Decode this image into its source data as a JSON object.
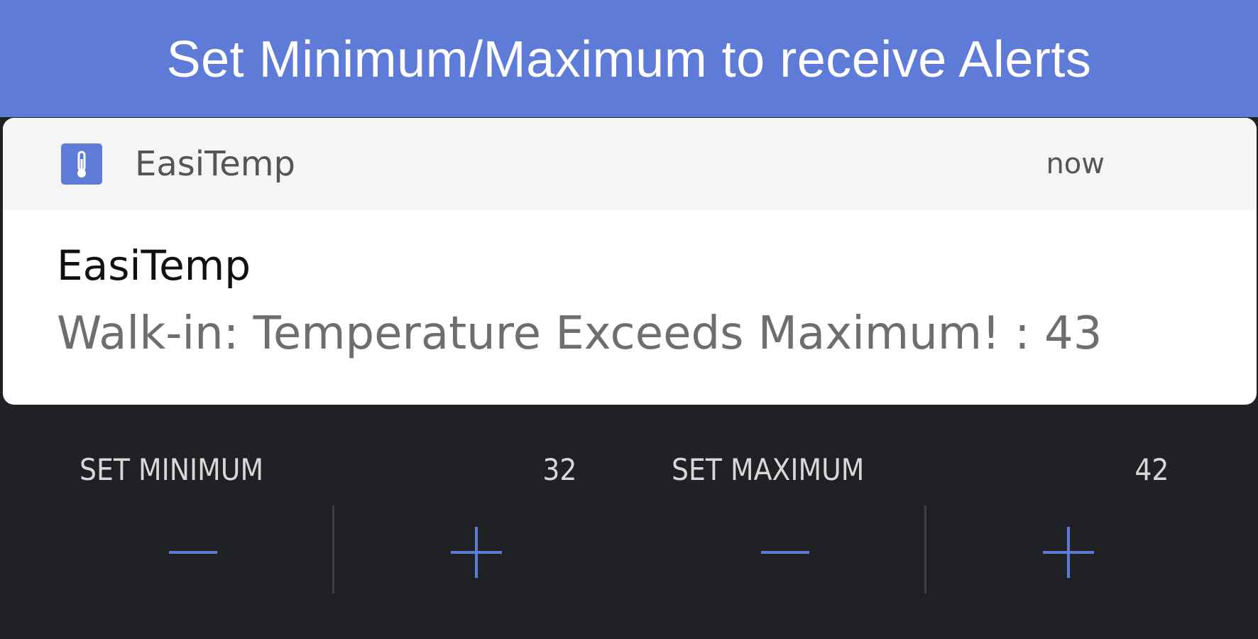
{
  "banner": {
    "title": "Set Minimum/Maximum to receive Alerts"
  },
  "notification": {
    "app_icon": "thermometer-icon",
    "app_name": "EasiTemp",
    "time": "now",
    "title": "EasiTemp",
    "message": "Walk-in: Temperature Exceeds Maximum! : 43"
  },
  "controls": {
    "minimum": {
      "label": "SET MINIMUM",
      "value": "32",
      "decrement_icon": "minus-icon",
      "increment_icon": "plus-icon"
    },
    "maximum": {
      "label": "SET MAXIMUM",
      "value": "42",
      "decrement_icon": "minus-icon",
      "increment_icon": "plus-icon"
    }
  },
  "colors": {
    "accent": "#5f7bd8",
    "background": "#202124",
    "card": "#ffffff",
    "card_header": "#f5f5f5",
    "control_text": "#d8d8d8"
  }
}
